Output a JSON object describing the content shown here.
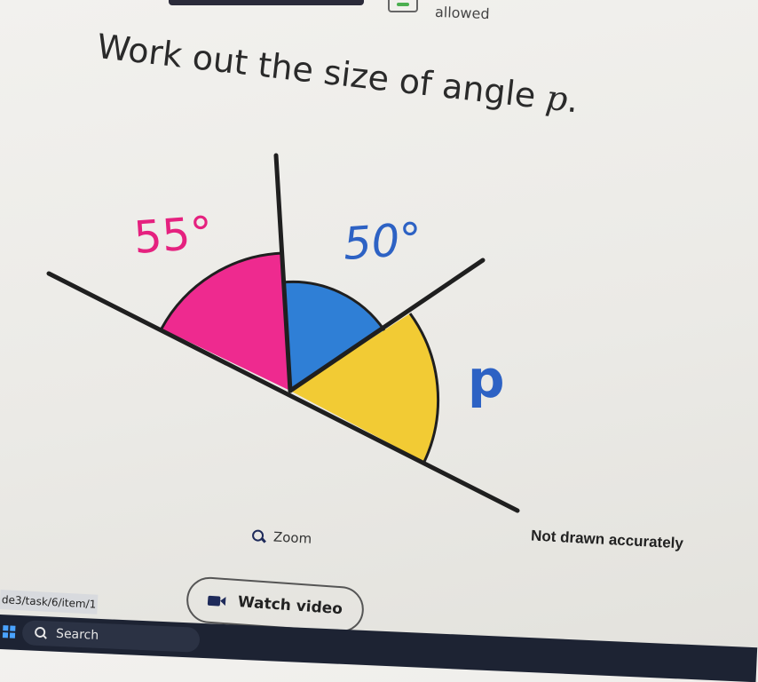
{
  "header": {
    "calculator_status": "allowed"
  },
  "question": {
    "prefix": "Work out the size of angle ",
    "variable": "p",
    "suffix": "."
  },
  "diagram": {
    "angle_a_label": "55°",
    "angle_b_label": "50°",
    "angle_p_label": "p",
    "colors": {
      "angle_a": "#ee2a8f",
      "angle_b": "#2f7fd6",
      "angle_p": "#f2cb34",
      "label_a": "#e5217f",
      "label_b": "#2d62c4",
      "label_p": "#2d62c4",
      "line": "#1f1f1f"
    }
  },
  "controls": {
    "zoom_label": "Zoom",
    "note": "Not drawn accurately",
    "watch_video_label": "Watch video"
  },
  "browser": {
    "url_fragment": "de3/task/6/item/1"
  },
  "taskbar": {
    "search_label": "Search"
  }
}
